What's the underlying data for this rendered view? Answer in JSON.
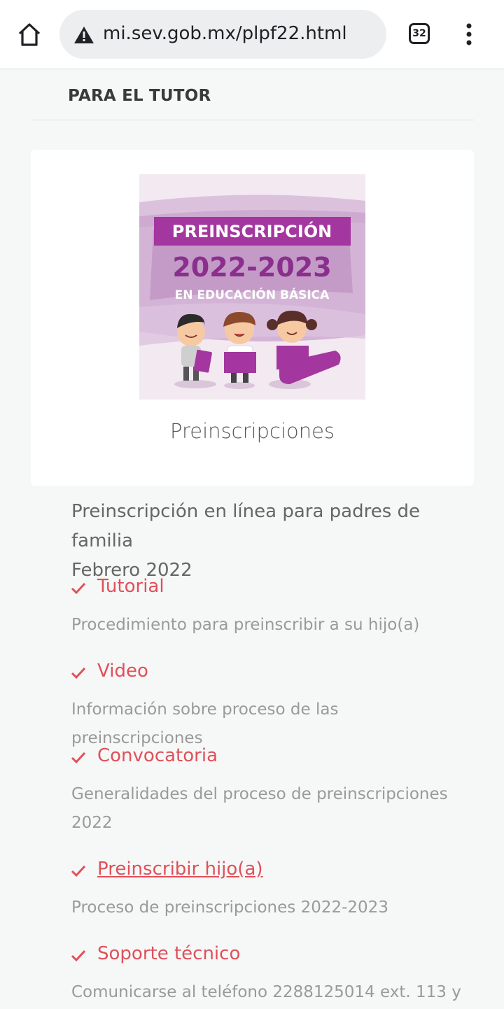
{
  "browser": {
    "url": "mi.sev.gob.mx/plpf22.html",
    "tab_count": "32"
  },
  "page": {
    "section_title": "PARA EL TUTOR",
    "card": {
      "poster": {
        "line1": "PREINSCRIPCIÓN",
        "line2": "2022-2023",
        "line3": "EN EDUCACIÓN BÁSICA"
      },
      "caption": "Preinscripciones"
    },
    "intro_line1": "Preinscripción en línea para padres de familia",
    "intro_line2": "Febrero 2022",
    "items": [
      {
        "title": "Tutorial",
        "desc": "Procedimiento para preinscribir a su hijo(a)"
      },
      {
        "title": "Video",
        "desc": "Información sobre proceso de las preinscripciones"
      },
      {
        "title": "Convocatoria",
        "desc": "Generalidades del proceso de preinscripciones 2022"
      },
      {
        "title": "Preinscribir hijo(a)",
        "desc": "Proceso de preinscripciones 2022-2023"
      },
      {
        "title": "Soporte técnico",
        "desc": "Comunicarse al teléfono 2288125014 ext. 113 y"
      }
    ]
  },
  "colors": {
    "accent_red": "#e0505a",
    "poster_purple": "#8a2f8e",
    "poster_banner": "#a3379f"
  }
}
